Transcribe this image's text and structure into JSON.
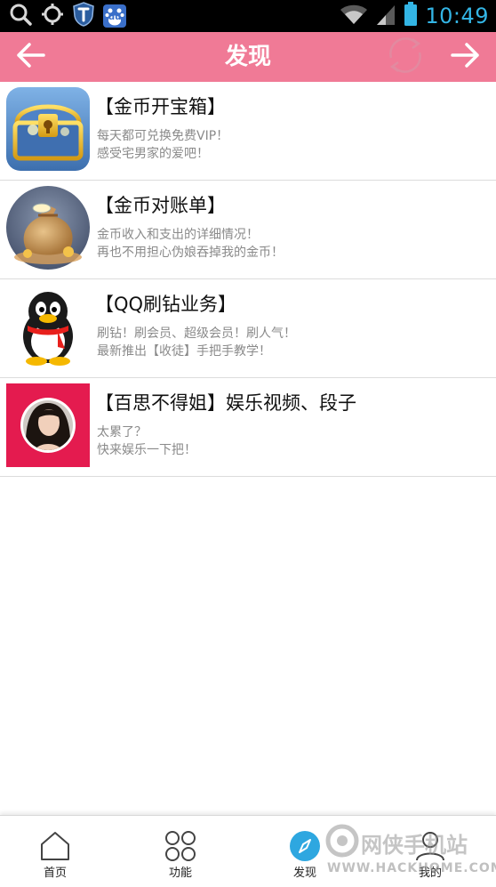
{
  "status_bar": {
    "time": "10:49",
    "icons": [
      "search-icon",
      "crosshair-icon",
      "shield-icon",
      "baidu-icon",
      "wifi-icon",
      "signal-icon",
      "battery-icon"
    ],
    "baidu_text": "du"
  },
  "title_bar": {
    "title": "发现",
    "background_color": "#f07a96"
  },
  "items": [
    {
      "title": "【金币开宝箱】",
      "line1": "每天都可兑换免费VIP！",
      "line2": "感受宅男家的爱吧！",
      "icon": "treasure-chest-icon"
    },
    {
      "title": "【金币对账单】",
      "line1": "金币收入和支出的详细情况！",
      "line2": "再也不用担心伪娘吞掉我的金币！",
      "icon": "money-bag-icon"
    },
    {
      "title": "【QQ刷钻业务】",
      "line1": "刷钻！刷会员、超级会员！刷人气！",
      "line2": "最新推出【收徒】手把手教学！",
      "icon": "qq-penguin-icon"
    },
    {
      "title": "【百思不得姐】娱乐视频、段子",
      "line1": "太累了？",
      "line2": "快来娱乐一下把！",
      "icon": "girl-avatar-icon"
    }
  ],
  "bottom_nav": [
    {
      "label": "首页",
      "icon": "home-icon",
      "active": false
    },
    {
      "label": "功能",
      "icon": "grid-icon",
      "active": false
    },
    {
      "label": "发现",
      "icon": "compass-icon",
      "active": true
    },
    {
      "label": "我的",
      "icon": "user-icon",
      "active": false
    }
  ],
  "watermark": {
    "text": "网侠手机站",
    "url": "WWW.HACKHOME.COM"
  },
  "colors": {
    "accent": "#f07a96",
    "active_nav": "#2ea7e0",
    "status_time": "#33b5e5"
  }
}
